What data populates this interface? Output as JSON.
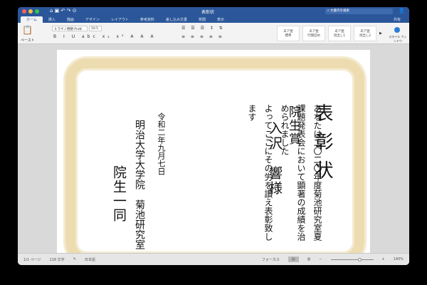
{
  "window": {
    "title": "表彰状",
    "search_placeholder": "文書内を検索",
    "share": "共有"
  },
  "tabs": [
    "ホーム",
    "挿入",
    "描画",
    "デザイン",
    "レイアウト",
    "参考資料",
    "差し込み文書",
    "校閲",
    "表示"
  ],
  "ribbon": {
    "paste": "ペースト",
    "font": "ヒラギノ明朝 ProN",
    "size": "10.5",
    "styles": [
      {
        "sample": "あア亜",
        "label": "標準"
      },
      {
        "sample": "あア亜",
        "label": "行間詰め"
      },
      {
        "sample": "あア亜",
        "label": "見出し1"
      },
      {
        "sample": "あア亜",
        "label": "見出し2"
      }
    ],
    "style_pane": "スタイル ウィンドウ"
  },
  "document": {
    "title": "表彰状",
    "award": "院生賞",
    "recipient": "入沢　響様",
    "body": [
      "あなたは二〇二〇年度菊池研究室夏",
      "課題発表会において顕著の成績を治",
      "められました",
      "よってここにその労を讃え表彰致し",
      "ます"
    ],
    "date": "令和二年九月七日",
    "org": "明治大学大学院　菊池研究室",
    "signer": "院生一同"
  },
  "status": {
    "page": "1/1 ページ",
    "words": "118 文字",
    "lang": "日本語",
    "focus": "フォーカス",
    "zoom": "140%"
  }
}
